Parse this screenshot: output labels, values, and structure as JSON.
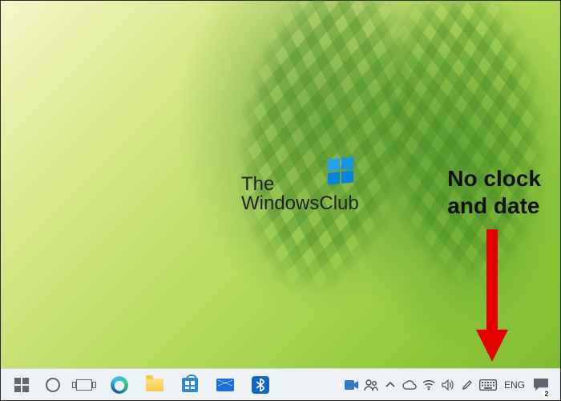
{
  "watermark": {
    "line1": "The",
    "line2": "WindowsClub"
  },
  "annotation": {
    "line1": "No clock",
    "line2": "and date",
    "arrow_color": "#e50000"
  },
  "taskbar": {
    "pinned": [
      {
        "name": "start-button",
        "icon": "windows-start-icon"
      },
      {
        "name": "cortana-button",
        "icon": "cortana-circle-icon"
      },
      {
        "name": "task-view-button",
        "icon": "task-view-icon"
      },
      {
        "name": "edge-browser",
        "icon": "edge-icon"
      },
      {
        "name": "file-explorer",
        "icon": "folder-icon"
      },
      {
        "name": "microsoft-store",
        "icon": "store-icon"
      },
      {
        "name": "mail-app",
        "icon": "mail-icon"
      },
      {
        "name": "bluetooth-app",
        "icon": "bluetooth-icon"
      }
    ],
    "tray": {
      "meet_now": "meet-now-icon",
      "people": "people-icon",
      "overflow": "chevron-up-icon",
      "onedrive": "cloud-icon",
      "network": "wifi-icon",
      "volume": "speaker-icon",
      "pen": "pen-icon",
      "touch_keyboard": "keyboard-icon",
      "language": "ENG",
      "action_center_badge": "2"
    }
  }
}
